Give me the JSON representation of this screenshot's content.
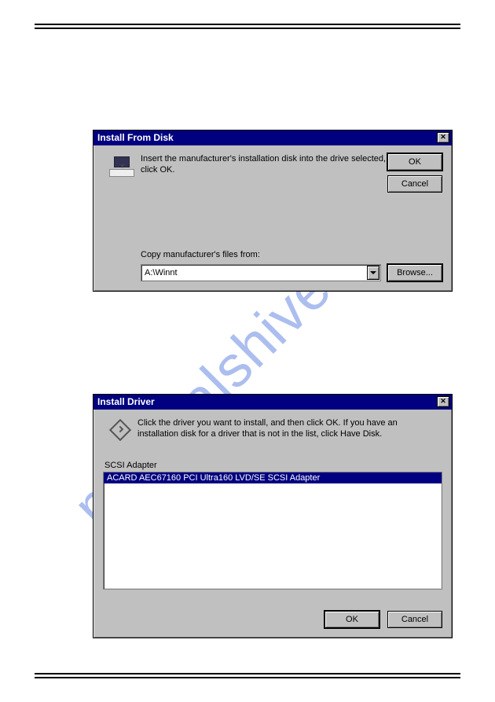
{
  "watermark": "manualshive.com",
  "dialog1": {
    "title": "Install From Disk",
    "instruction": "Insert the manufacturer's installation disk into the drive selected, and then click OK.",
    "buttons": {
      "ok": "OK",
      "cancel": "Cancel",
      "browse": "Browse..."
    },
    "copy_label": "Copy manufacturer's files from:",
    "path_value": "A:\\Winnt"
  },
  "dialog2": {
    "title": "Install Driver",
    "instruction": "Click the driver you want to install, and then click OK. If you have an installation disk for a driver that is not in the list, click Have Disk.",
    "list_label": "SCSI Adapter",
    "list_items": [
      "ACARD AEC67160 PCI Ultra160 LVD/SE SCSI Adapter"
    ],
    "buttons": {
      "ok": "OK",
      "cancel": "Cancel"
    }
  }
}
